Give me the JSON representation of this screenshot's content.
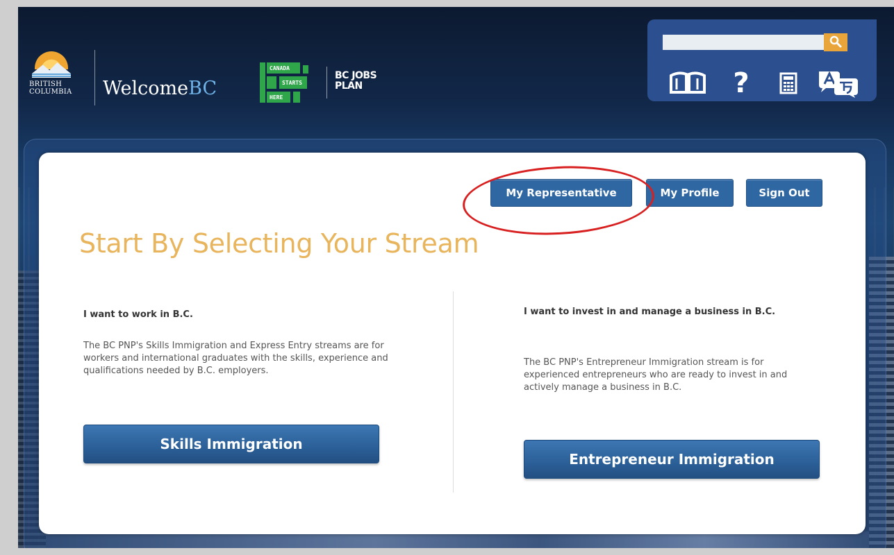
{
  "header": {
    "gov_logo_text": [
      "BRITISH",
      "COLUMBIA"
    ],
    "site_name_prefix": "Welcome",
    "site_name_suffix": "BC",
    "campaign_logo_lines": [
      "CANADA",
      "STARTS",
      "HERE"
    ],
    "campaign_title_lines": [
      "BC JOBS",
      "PLAN"
    ]
  },
  "tools": {
    "search_value": "",
    "icons": [
      "book-icon",
      "help-icon",
      "calculator-icon",
      "translate-icon"
    ]
  },
  "nav": {
    "my_representative": "My Representative",
    "my_profile": "My Profile",
    "sign_out": "Sign Out"
  },
  "main": {
    "title": "Start By Selecting Your Stream",
    "left": {
      "heading": "I want to work in B.C.",
      "description": "The BC PNP's Skills Immigration and Express Entry streams are for workers and international graduates with the skills, experience and qualifications needed by B.C. employers.",
      "button": "Skills Immigration"
    },
    "right": {
      "heading": "I want to invest in and manage a business in B.C.",
      "description": "The BC PNP's Entrepreneur Immigration stream is for experienced entrepreneurs who are ready to invest in and actively manage a business in B.C.",
      "button": "Entrepreneur Immigration"
    }
  },
  "colors": {
    "accent_title": "#e8b45c",
    "button_blue": "#2f67a3",
    "tool_panel": "#2c4f90",
    "highlight_circle": "#d82020"
  }
}
